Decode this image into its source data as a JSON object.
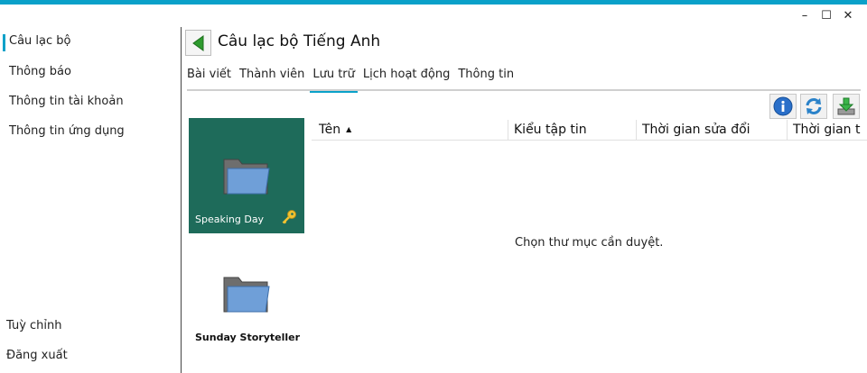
{
  "window": {
    "controls": {
      "minimize": "–",
      "maximize": "☐",
      "close": "✕"
    },
    "accent_color": "#0aa1c9"
  },
  "sidebar": {
    "items": [
      {
        "label": "Câu lạc bộ",
        "active": true
      },
      {
        "label": "Thông báo"
      },
      {
        "label": "Thông tin tài khoản"
      },
      {
        "label": "Thông tin ứng dụng"
      }
    ],
    "bottom": [
      {
        "label": "Tuỳ chỉnh"
      },
      {
        "label": "Đăng xuất"
      }
    ]
  },
  "header": {
    "title": "Câu lạc bộ Tiếng Anh",
    "back_icon": "back-arrow-icon"
  },
  "tabs": [
    {
      "label": "Bài viết"
    },
    {
      "label": "Thành viên"
    },
    {
      "label": "Lưu trữ",
      "active": true
    },
    {
      "label": "Lịch hoạt động"
    },
    {
      "label": "Thông tin"
    }
  ],
  "toolbar": [
    {
      "icon": "info-icon"
    },
    {
      "icon": "refresh-icon"
    },
    {
      "icon": "download-icon"
    }
  ],
  "folders": [
    {
      "name": "Speaking Day",
      "selected": true,
      "has_key": true,
      "tile_color": "#1e6b5a"
    },
    {
      "name": "Sunday Storyteller",
      "selected": false
    }
  ],
  "file_table": {
    "columns": [
      {
        "label": "Tên",
        "sort": "ascending"
      },
      {
        "label": "Kiểu tập tin"
      },
      {
        "label": "Thời gian sửa đổi"
      },
      {
        "label": "Thời gian t"
      }
    ],
    "sort_indicator": "▲",
    "empty_message": "Chọn thư mục cần duyệt."
  }
}
